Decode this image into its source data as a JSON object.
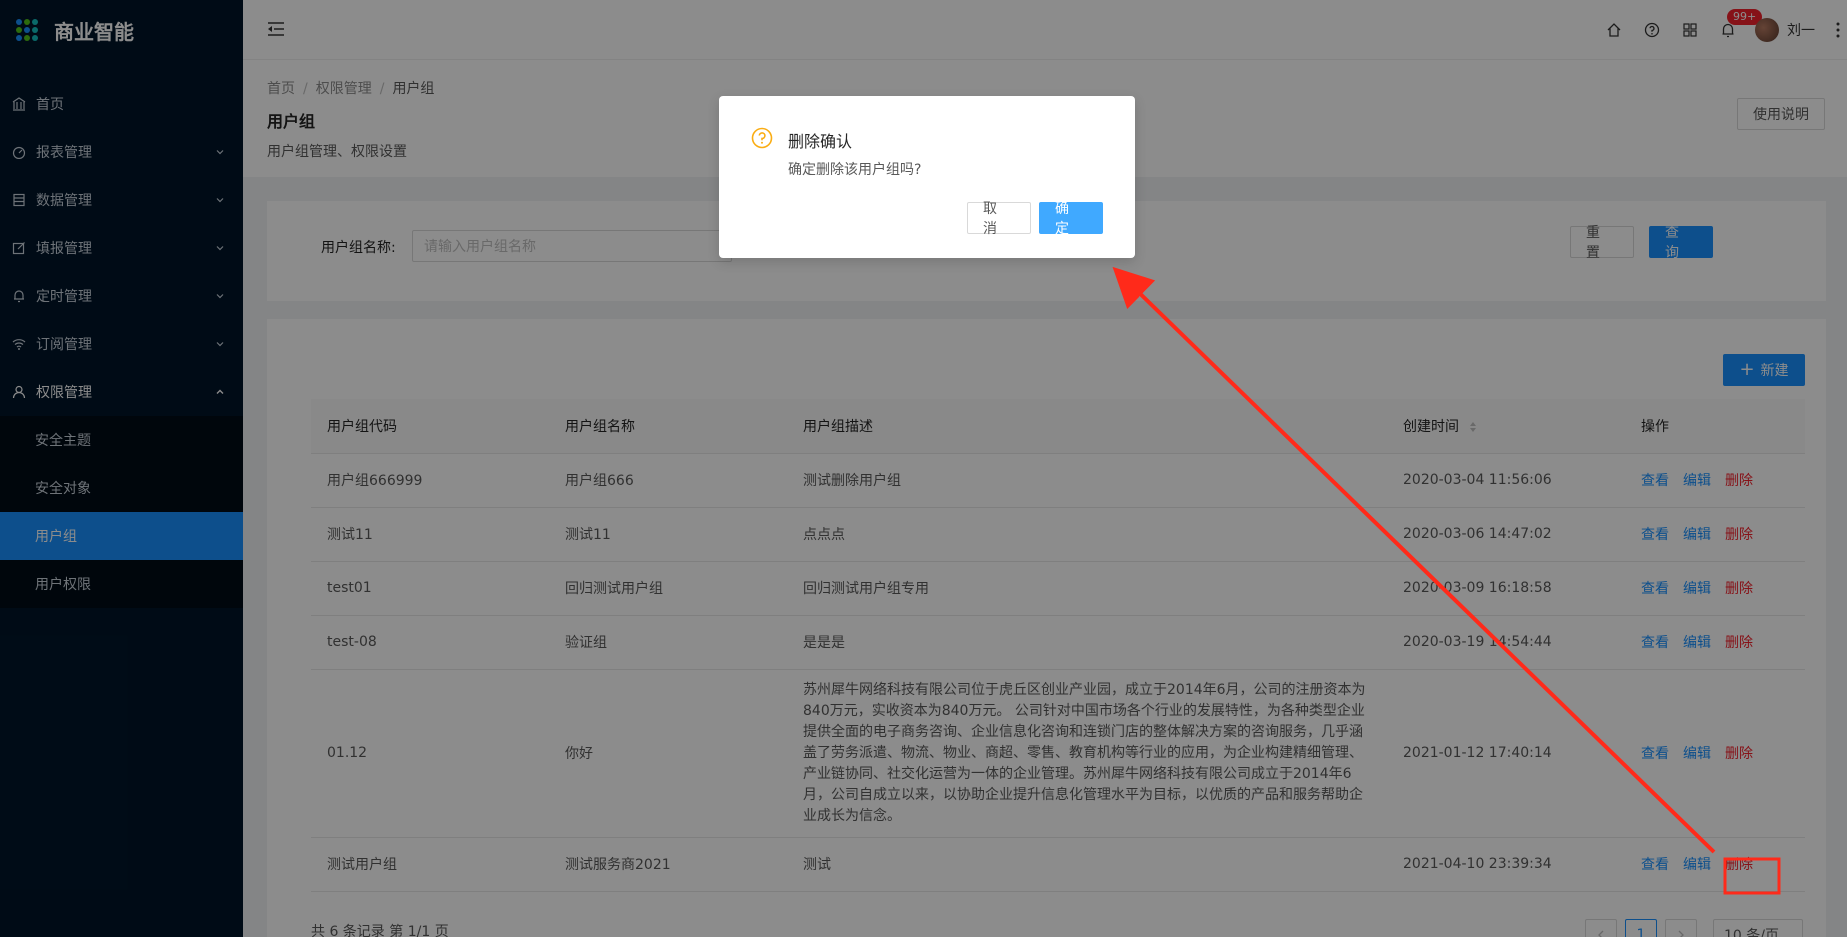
{
  "app": {
    "name": "商业智能"
  },
  "sidebar": {
    "items": [
      {
        "label": "首页",
        "icon": "bank-icon",
        "expandable": false
      },
      {
        "label": "报表管理",
        "icon": "dashboard-icon",
        "expandable": true
      },
      {
        "label": "数据管理",
        "icon": "database-icon",
        "expandable": true
      },
      {
        "label": "填报管理",
        "icon": "edit-icon",
        "expandable": true
      },
      {
        "label": "定时管理",
        "icon": "bell-icon",
        "expandable": true
      },
      {
        "label": "订阅管理",
        "icon": "wifi-icon",
        "expandable": true
      },
      {
        "label": "权限管理",
        "icon": "user-icon",
        "expandable": true,
        "open": true
      }
    ],
    "subitems": [
      {
        "label": "安全主题",
        "active": false
      },
      {
        "label": "安全对象",
        "active": false
      },
      {
        "label": "用户组",
        "active": true
      },
      {
        "label": "用户权限",
        "active": false
      }
    ]
  },
  "topbar": {
    "badge": "99+",
    "user_name": "刘一"
  },
  "breadcrumb": [
    "首页",
    "权限管理",
    "用户组"
  ],
  "page": {
    "title": "用户组",
    "description": "用户组管理、权限设置",
    "help_label": "使用说明"
  },
  "search": {
    "label": "用户组名称:",
    "placeholder": "请输入用户组名称",
    "reset_label": "重 置",
    "query_label": "查 询"
  },
  "table": {
    "new_label": "新建",
    "columns": [
      "用户组代码",
      "用户组名称",
      "用户组描述",
      "创建时间",
      "操作"
    ],
    "actions": {
      "view": "查看",
      "edit": "编辑",
      "delete": "删除"
    },
    "rows": [
      {
        "code": "用户组666999",
        "name": "用户组666",
        "desc": "测试删除用户组",
        "time": "2020-03-04 11:56:06"
      },
      {
        "code": "测试11",
        "name": "测试11",
        "desc": "点点点",
        "time": "2020-03-06 14:47:02"
      },
      {
        "code": "test01",
        "name": "回归测试用户组",
        "desc": "回归测试用户组专用",
        "time": "2020-03-09 16:18:58"
      },
      {
        "code": "test-08",
        "name": "验证组",
        "desc": "是是是",
        "time": "2020-03-19 14:54:44"
      },
      {
        "code": "01.12",
        "name": "你好",
        "desc": "苏州犀牛网络科技有限公司位于虎丘区创业产业园，成立于2014年6月，公司的注册资本为840万元，实收资本为840万元。 公司针对中国市场各个行业的发展特性，为各种类型企业提供全面的电子商务咨询、企业信息化咨询和连锁门店的整体解决方案的咨询服务，几乎涵盖了劳务派遣、物流、物业、商超、零售、教育机构等行业的应用，为企业构建精细管理、产业链协同、社交化运营为一体的企业管理。苏州犀牛网络科技有限公司成立于2014年6月，公司自成立以来，以协助企业提升信息化管理水平为目标，以优质的产品和服务帮助企业成长为信念。",
        "time": "2021-01-12 17:40:14"
      },
      {
        "code": "测试用户组",
        "name": "测试服务商2021",
        "desc": "测试",
        "time": "2021-04-10 23:39:34"
      }
    ],
    "footer": "共 6 条记录 第 1/1 页",
    "current_page": "1",
    "page_size": "10 条/页"
  },
  "modal": {
    "title": "删除确认",
    "content": "确定删除该用户组吗?",
    "cancel_label": "取 消",
    "ok_label": "确 定"
  },
  "colors": {
    "primary": "#1890ff",
    "danger": "#f5222d",
    "sidebar_bg": "#001529",
    "annotation": "#ff2a1a"
  }
}
